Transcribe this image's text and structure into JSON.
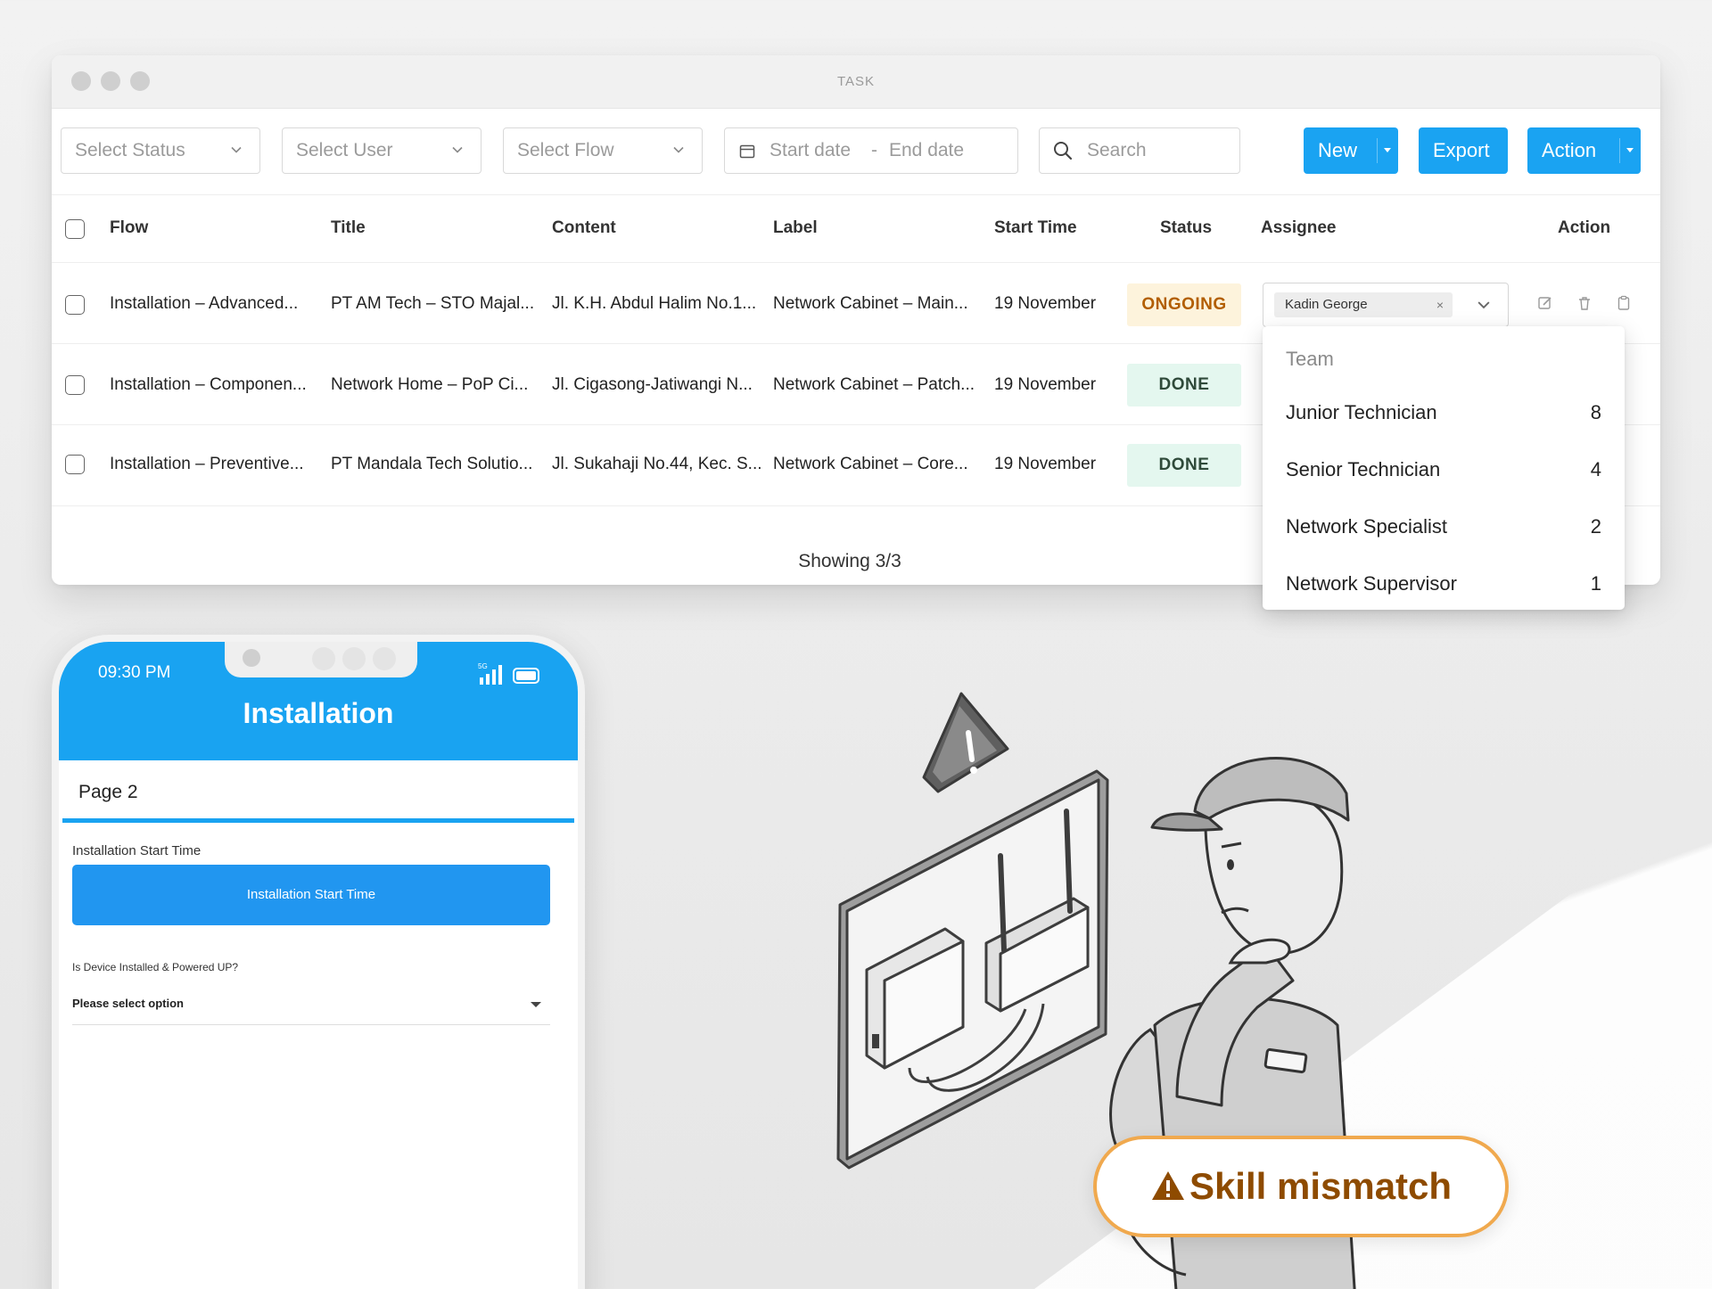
{
  "window": {
    "title": "TASK",
    "filters": {
      "status_placeholder": "Select Status",
      "user_placeholder": "Select User",
      "flow_placeholder": "Select Flow",
      "start_date_placeholder": "Start date",
      "date_separator": "-",
      "end_date_placeholder": "End date",
      "search_placeholder": "Search"
    },
    "buttons": {
      "new": "New",
      "export": "Export",
      "action": "Action"
    },
    "table": {
      "headers": [
        "Flow",
        "Title",
        "Content",
        "Label",
        "Start Time",
        "Status",
        "Assignee",
        "Action"
      ],
      "rows": [
        {
          "flow": "Installation – Advanced...",
          "title": "PT AM Tech – STO Majal...",
          "content": "Jl. K.H. Abdul Halim No.1...",
          "label": "Network Cabinet – Main...",
          "start_time": "19 November",
          "status": "ONGOING",
          "assignee": "Kadin George"
        },
        {
          "flow": "Installation – Componen...",
          "title": "Network Home – PoP Ci...",
          "content": "Jl. Cigasong-Jatiwangi N...",
          "label": "Network Cabinet – Patch...",
          "start_time": "19 November",
          "status": "DONE"
        },
        {
          "flow": "Installation – Preventive...",
          "title": "PT Mandala Tech Solutio...",
          "content": "Jl. Sukahaji No.44, Kec. S...",
          "label": "Network Cabinet – Core...",
          "start_time": "19 November",
          "status": "DONE"
        }
      ],
      "footer": "Showing 3/3"
    },
    "assignee_dropdown": {
      "header": "Team",
      "items": [
        {
          "label": "Junior Technician",
          "count": "8"
        },
        {
          "label": "Senior Technician",
          "count": "4"
        },
        {
          "label": "Network Specialist",
          "count": "2"
        },
        {
          "label": "Network Supervisor",
          "count": "1"
        }
      ]
    }
  },
  "phone": {
    "time": "09:30 PM",
    "signal_label": "5G",
    "title": "Installation",
    "page_label": "Page 2",
    "field1_label": "Installation Start Time",
    "field1_button": "Installation Start Time",
    "field2_label": "Is Device Installed & Powered UP?",
    "field2_placeholder": "Please select option"
  },
  "callout": {
    "text": "Skill mismatch"
  },
  "colors": {
    "primary": "#1aa3f2",
    "ongoing_bg": "#fdf3dc",
    "ongoing_text": "#b25e00",
    "done_bg": "#e4f7ef",
    "done_text": "#2f4a3a",
    "callout_border": "#f0a94e",
    "callout_text": "#8e4b00"
  },
  "icons": [
    "chevron-down-icon",
    "calendar-icon",
    "search-icon",
    "edit-icon",
    "trash-icon",
    "clipboard-icon",
    "signal-icon",
    "battery-icon",
    "warning-icon"
  ]
}
